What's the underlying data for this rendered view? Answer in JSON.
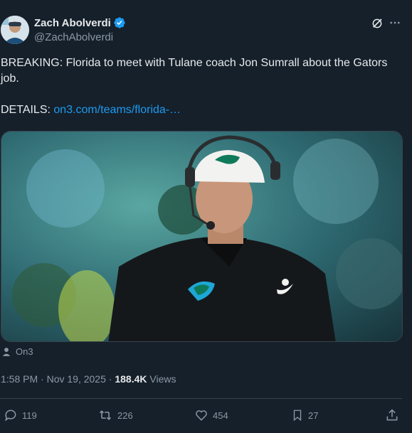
{
  "author": {
    "name": "Zach Abolverdi",
    "handle": "@ZachAbolverdi",
    "verified_color": "#1d9bf0"
  },
  "post": {
    "line1": "BREAKING: Florida to meet with Tulane coach Jon Sumrall about the Gators job.",
    "details_label": "DETAILS: ",
    "details_link": "on3.com/teams/florida-…"
  },
  "media": {
    "source": "On3"
  },
  "meta": {
    "time": "1:58 PM",
    "sep1": " · ",
    "date": "Nov 19, 2025",
    "sep2": " · ",
    "views": "188.4K",
    "views_label": " Views"
  },
  "actions": {
    "replies": "119",
    "reposts": "226",
    "likes": "454",
    "bookmarks": "27"
  },
  "icons": [
    "verified-icon",
    "grok-icon",
    "more-icon",
    "person-icon",
    "reply-icon",
    "repost-icon",
    "like-icon",
    "bookmark-icon",
    "share-icon"
  ]
}
